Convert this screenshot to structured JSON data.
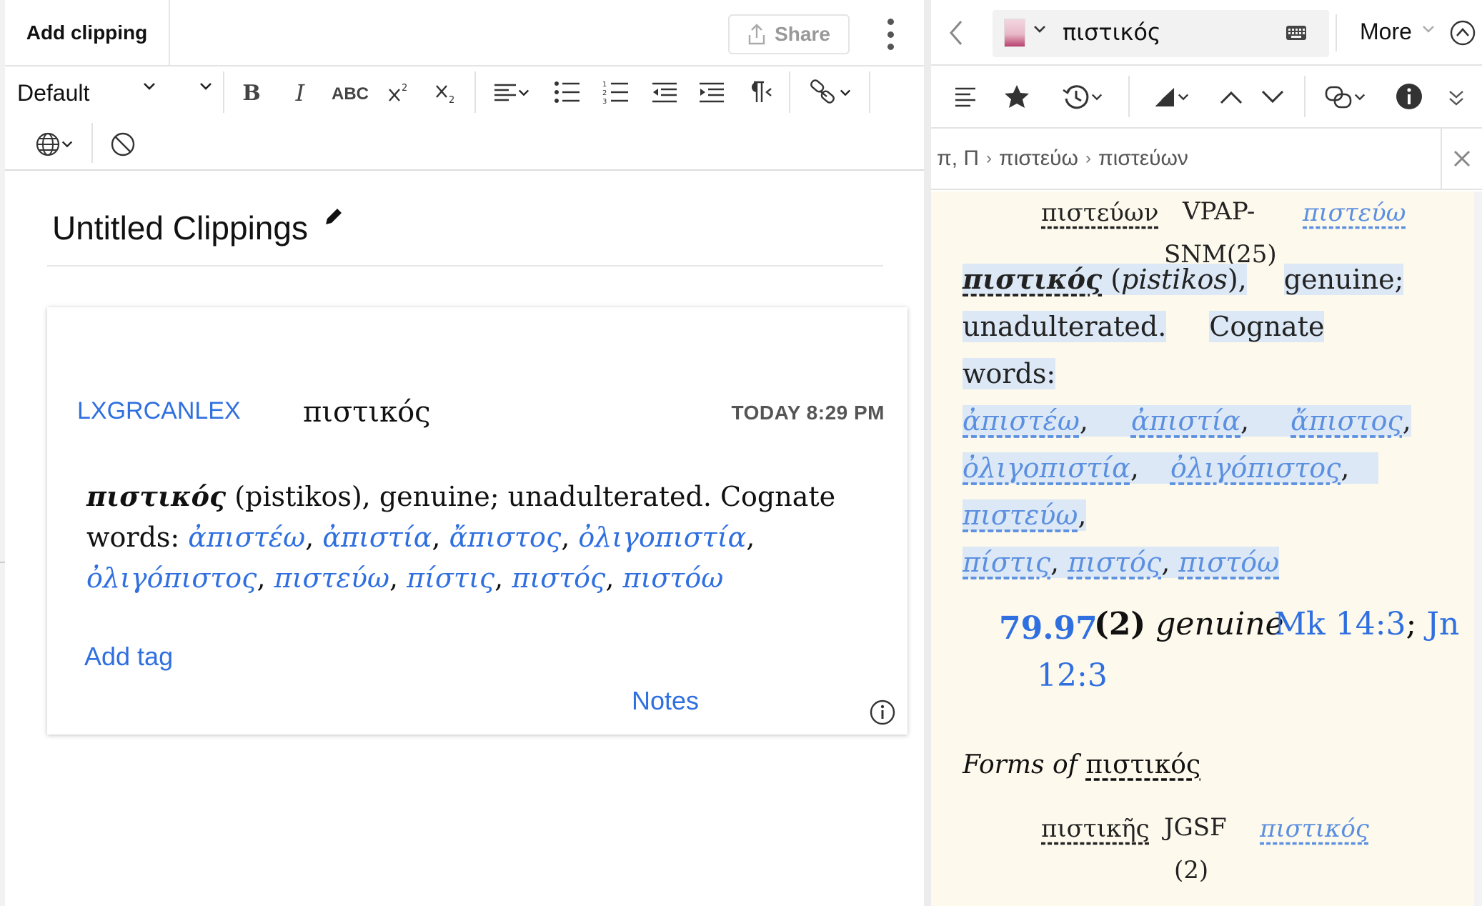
{
  "clipping_panel": {
    "tab_label": "Add clipping",
    "share_label": "Share",
    "style_select": "Default",
    "toolbar_items": [
      "bold-icon",
      "italic-icon",
      "small-caps-icon",
      "superscript-icon",
      "subscript-icon",
      "align-icon",
      "bullet-list-icon",
      "numbered-list-icon",
      "outdent-icon",
      "indent-icon",
      "paragraph-direction-icon",
      "link-icon",
      "language-globe-icon",
      "clear-format-icon"
    ],
    "toolbar_text": {
      "bold": "B",
      "italic": "I",
      "small_caps": "ABC"
    },
    "document_title": "Untitled Clippings",
    "card": {
      "source": "LXGRCANLEX",
      "headword": "πιστικός",
      "timestamp": "TODAY 8:29 PM",
      "lemma": "πιστικός",
      "body_before": " (pistikos), genuine; unadulterated. Cognate words: ",
      "cognates": [
        "ἀπιστέω",
        "ἀπιστία",
        "ἄπιστος",
        "ὀλιγοπιστία",
        "ὀλιγόπιστος",
        "πιστεύω",
        "πίστις",
        "πιστός",
        "πιστόω"
      ],
      "add_tag_label": "Add tag",
      "notes_label": "Notes"
    }
  },
  "resource_panel": {
    "resource_title": "πιστικός",
    "more_label": "More",
    "breadcrumb": [
      "π, Π",
      "πιστεύω",
      "πιστεύων"
    ],
    "content": {
      "row1": {
        "form": "πιστεύων",
        "parse_a": "VPAP-",
        "parse_b": "SNM(25)",
        "lemma": "πιστεύω"
      },
      "lemma": "πιστικός",
      "translit": "pistikos",
      "gloss_a": "genuine;",
      "gloss_b": "unadulterated.",
      "cognate_a": "Cognate",
      "cognate_b": "words:",
      "cognates": [
        "ἀπιστέω",
        "ἀπιστία",
        "ἄπιστος",
        "ὀλιγοπιστία",
        "ὀλιγόπιστος",
        "πιστεύω",
        "πίστις",
        "πιστός",
        "πιστόω"
      ],
      "ref_num": "79.97",
      "ref_count": "(2)",
      "ref_gloss": "genuine",
      "ref_links": [
        "Mk 14:3",
        "Jn"
      ],
      "ref_cont": "12:3",
      "forms_label": "Forms of",
      "forms_lemma": "πιστικός",
      "form_row": {
        "form": "πιστικῆς",
        "parse": "JGSF",
        "count": "(2)",
        "lemma": "πιστικός"
      }
    }
  },
  "colors": {
    "accent": "#2f6fe0",
    "highlight": "#dce8f5",
    "content_bg": "#fdf9ec"
  }
}
